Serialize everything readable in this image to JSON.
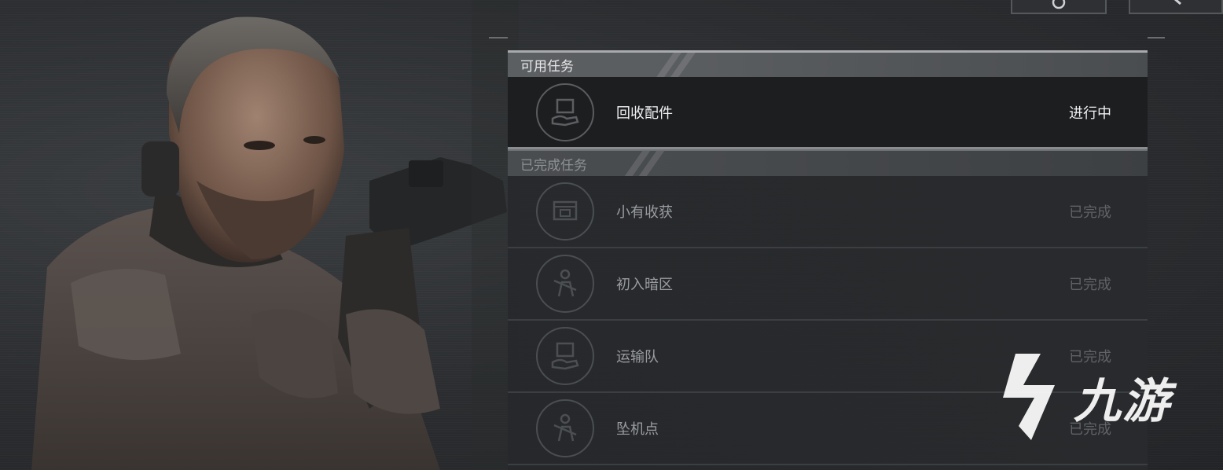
{
  "top_buttons": {
    "settings_icon": "gear-icon",
    "search_icon": "search-icon"
  },
  "available_section": {
    "title": "可用任务",
    "tasks": [
      {
        "name": "回收配件",
        "status": "进行中",
        "icon": "package-hand-icon"
      }
    ]
  },
  "completed_section": {
    "title": "已完成任务",
    "tasks": [
      {
        "name": "小有收获",
        "status": "已完成",
        "icon": "crate-icon"
      },
      {
        "name": "初入暗区",
        "status": "已完成",
        "icon": "soldier-icon"
      },
      {
        "name": "运输队",
        "status": "已完成",
        "icon": "package-hand-icon"
      },
      {
        "name": "坠机点",
        "status": "已完成",
        "icon": "soldier-icon"
      }
    ]
  },
  "watermark": {
    "text": "九游",
    "icon": "jiuyou-logo-icon"
  },
  "colors": {
    "panel_bg": "#282a2d",
    "active_row_bg": "#1c1e20",
    "header_bg": "#5c5f62",
    "text_active": "#f1f2f3",
    "text_done": "#606366"
  }
}
